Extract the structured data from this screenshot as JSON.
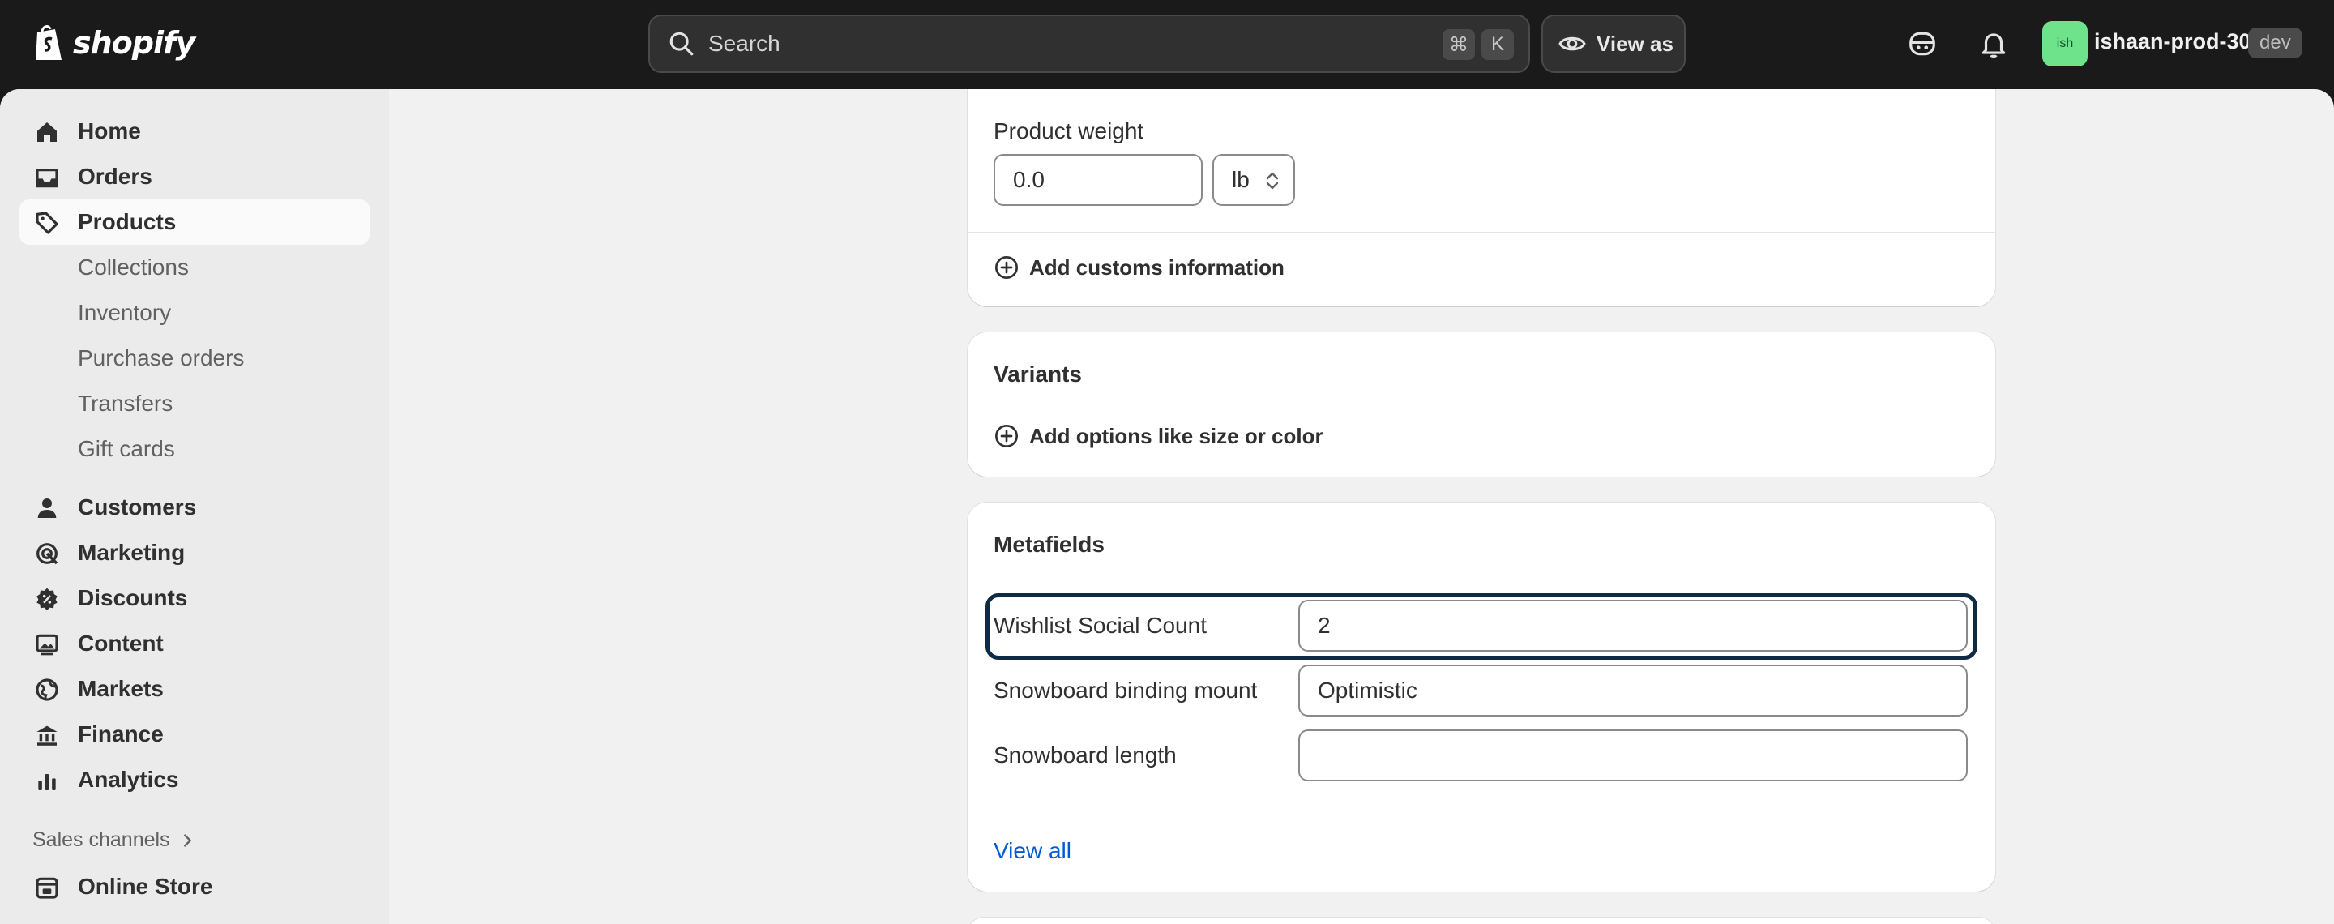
{
  "topbar": {
    "logo_text": "shopify",
    "search_placeholder": "Search",
    "kbd_cmd": "⌘",
    "kbd_k": "K",
    "view_as_label": "View as",
    "avatar_initials": "ish",
    "store_name": "ishaan-prod-30",
    "store_badge": "dev"
  },
  "sidebar": {
    "items": [
      {
        "label": "Home",
        "icon": "home-icon"
      },
      {
        "label": "Orders",
        "icon": "inbox-icon"
      },
      {
        "label": "Products",
        "icon": "tag-icon",
        "active": true
      },
      {
        "label": "Customers",
        "icon": "person-icon"
      },
      {
        "label": "Marketing",
        "icon": "target-icon"
      },
      {
        "label": "Discounts",
        "icon": "discount-icon"
      },
      {
        "label": "Content",
        "icon": "image-icon"
      },
      {
        "label": "Markets",
        "icon": "globe-icon"
      },
      {
        "label": "Finance",
        "icon": "bank-icon"
      },
      {
        "label": "Analytics",
        "icon": "bar-chart-icon"
      }
    ],
    "product_subitems": [
      "Collections",
      "Inventory",
      "Purchase orders",
      "Transfers",
      "Gift cards"
    ],
    "sales_channels_title": "Sales channels",
    "online_store_label": "Online Store"
  },
  "shipping": {
    "weight_label": "Product weight",
    "weight_value": "0.0",
    "weight_unit": "lb",
    "customs_link": "Add customs information"
  },
  "variants": {
    "title": "Variants",
    "add_options_link": "Add options like size or color"
  },
  "metafields": {
    "title": "Metafields",
    "rows": [
      {
        "label": "Wishlist Social Count",
        "value": "2"
      },
      {
        "label": "Snowboard binding mount",
        "value": "Optimistic"
      },
      {
        "label": "Snowboard length",
        "value": ""
      }
    ],
    "view_all": "View all"
  },
  "colors": {
    "topbar": "#1a1a1a",
    "sidebar": "#ebebeb",
    "main_bg": "#f1f1f1",
    "link": "#005bd3",
    "focus_ring": "#0f2a44",
    "avatar": "#6fe38b"
  }
}
